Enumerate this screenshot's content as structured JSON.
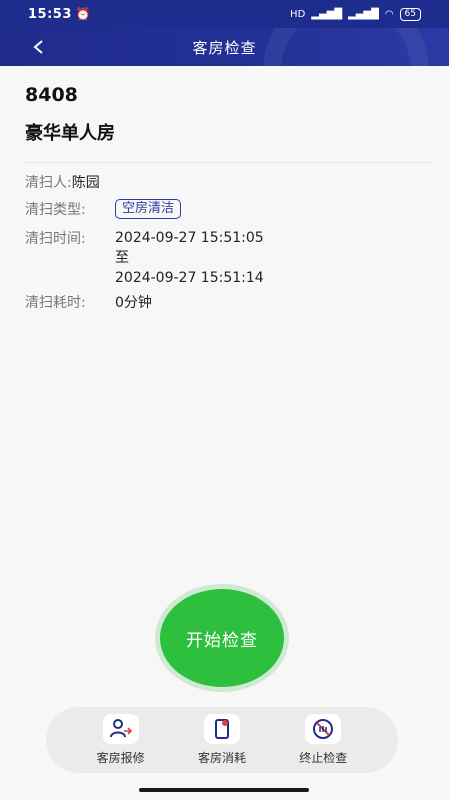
{
  "status": {
    "time": "15:53",
    "alarm_icon": "alarm-icon",
    "network_left": "HD",
    "battery": "65"
  },
  "header": {
    "title": "客房检查"
  },
  "room": {
    "number": "8408",
    "type": "豪华单人房"
  },
  "details": {
    "cleaner_label": "清扫人:",
    "cleaner_value": "陈园",
    "type_label": "清扫类型:",
    "type_value": "空房清洁",
    "time_label": "清扫时间:",
    "time_start": "2024-09-27 15:51:05",
    "time_sep": "至",
    "time_end": "2024-09-27 15:51:14",
    "duration_label": "清扫耗时:",
    "duration_value": "0分钟"
  },
  "actions": {
    "start_label": "开始检查"
  },
  "toolbar": {
    "report_label": "客房报修",
    "consume_label": "客房消耗",
    "stop_label": "终止检查"
  },
  "colors": {
    "header": "#1e2c8e",
    "accent": "#2b3ea2",
    "start": "#2fbf3f"
  }
}
